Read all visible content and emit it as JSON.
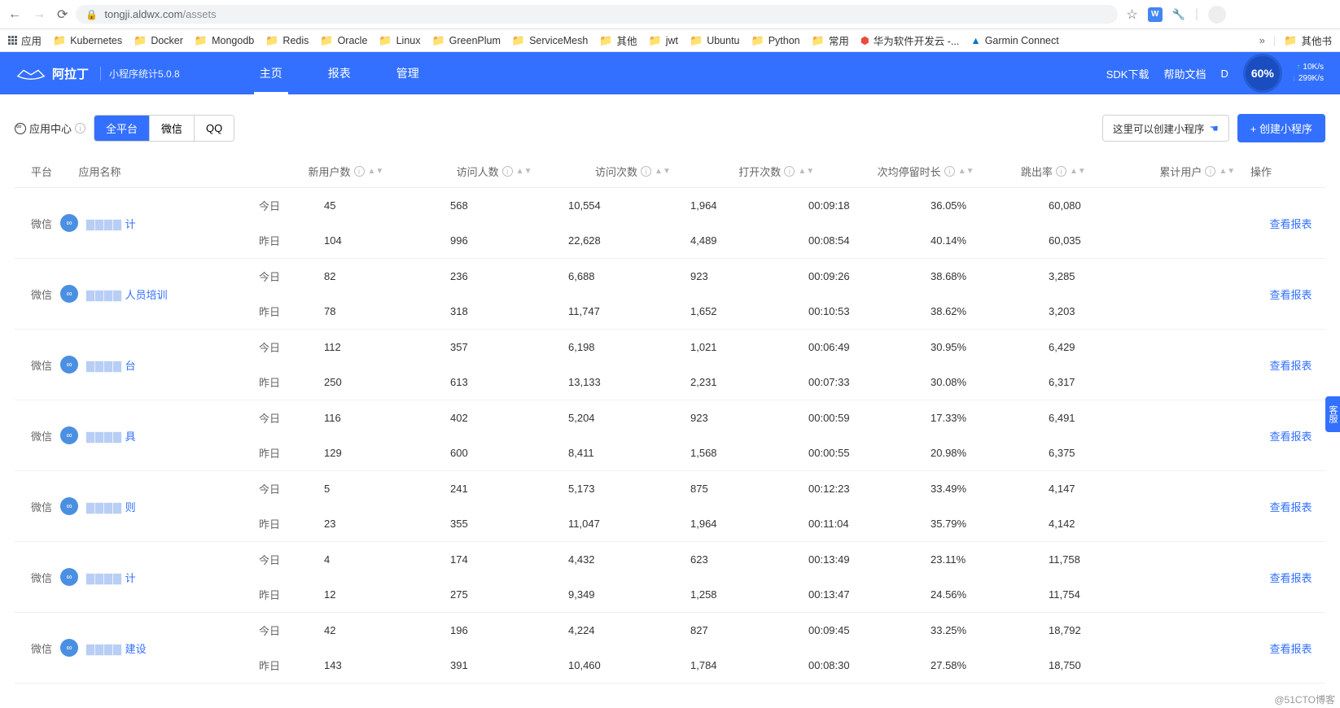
{
  "browser": {
    "url_host": "tongji.aldwx.com",
    "url_path": "/assets",
    "ext_badge": "W",
    "apps_label": "应用"
  },
  "bookmarks": [
    "Kubernetes",
    "Docker",
    "Mongodb",
    "Redis",
    "Oracle",
    "Linux",
    "GreenPlum",
    "ServiceMesh",
    "其他",
    "jwt",
    "Ubuntu",
    "Python",
    "常用"
  ],
  "bookmark_extra": {
    "huawei": "华为软件开发云 -...",
    "garmin": "Garmin Connect",
    "other": "其他书"
  },
  "header": {
    "brand": "阿拉丁",
    "sub": "小程序统计5.0.8",
    "nav": [
      "主页",
      "报表",
      "管理"
    ],
    "right": {
      "sdk": "SDK下载",
      "help": "帮助文档",
      "d_label": "D"
    },
    "gauge": "60%",
    "net_up": "10K/s",
    "net_down": "299K/s"
  },
  "toolbar": {
    "app_center": "应用中心",
    "filters": [
      "全平台",
      "微信",
      "QQ"
    ],
    "hint": "这里可以创建小程序",
    "create": "+ 创建小程序"
  },
  "table": {
    "headers": {
      "platform": "平台",
      "app_name": "应用名称",
      "new_users": "新用户数",
      "visitors": "访问人数",
      "visits": "访问次数",
      "opens": "打开次数",
      "avg_duration": "次均停留时长",
      "bounce_rate": "跳出率",
      "total_users": "累计用户",
      "action": "操作"
    },
    "day_today": "今日",
    "day_yesterday": "昨日",
    "view_report": "查看报表",
    "platform_wechat": "微信",
    "rows": [
      {
        "name_suffix": "计",
        "today": {
          "new": "45",
          "visitors": "568",
          "visits": "10,554",
          "opens": "1,964",
          "duration": "00:09:18",
          "bounce": "36.05%",
          "total": "60,080"
        },
        "yesterday": {
          "new": "104",
          "visitors": "996",
          "visits": "22,628",
          "opens": "4,489",
          "duration": "00:08:54",
          "bounce": "40.14%",
          "total": "60,035"
        }
      },
      {
        "name_suffix": "人员培训",
        "today": {
          "new": "82",
          "visitors": "236",
          "visits": "6,688",
          "opens": "923",
          "duration": "00:09:26",
          "bounce": "38.68%",
          "total": "3,285"
        },
        "yesterday": {
          "new": "78",
          "visitors": "318",
          "visits": "11,747",
          "opens": "1,652",
          "duration": "00:10:53",
          "bounce": "38.62%",
          "total": "3,203"
        }
      },
      {
        "name_suffix": "台",
        "today": {
          "new": "112",
          "visitors": "357",
          "visits": "6,198",
          "opens": "1,021",
          "duration": "00:06:49",
          "bounce": "30.95%",
          "total": "6,429"
        },
        "yesterday": {
          "new": "250",
          "visitors": "613",
          "visits": "13,133",
          "opens": "2,231",
          "duration": "00:07:33",
          "bounce": "30.08%",
          "total": "6,317"
        }
      },
      {
        "name_suffix": "具",
        "today": {
          "new": "116",
          "visitors": "402",
          "visits": "5,204",
          "opens": "923",
          "duration": "00:00:59",
          "bounce": "17.33%",
          "total": "6,491"
        },
        "yesterday": {
          "new": "129",
          "visitors": "600",
          "visits": "8,411",
          "opens": "1,568",
          "duration": "00:00:55",
          "bounce": "20.98%",
          "total": "6,375"
        }
      },
      {
        "name_suffix": "则",
        "today": {
          "new": "5",
          "visitors": "241",
          "visits": "5,173",
          "opens": "875",
          "duration": "00:12:23",
          "bounce": "33.49%",
          "total": "4,147"
        },
        "yesterday": {
          "new": "23",
          "visitors": "355",
          "visits": "11,047",
          "opens": "1,964",
          "duration": "00:11:04",
          "bounce": "35.79%",
          "total": "4,142"
        }
      },
      {
        "name_suffix": "计",
        "today": {
          "new": "4",
          "visitors": "174",
          "visits": "4,432",
          "opens": "623",
          "duration": "00:13:49",
          "bounce": "23.11%",
          "total": "11,758"
        },
        "yesterday": {
          "new": "12",
          "visitors": "275",
          "visits": "9,349",
          "opens": "1,258",
          "duration": "00:13:47",
          "bounce": "24.56%",
          "total": "11,754"
        }
      },
      {
        "name_suffix": "建设",
        "today": {
          "new": "42",
          "visitors": "196",
          "visits": "4,224",
          "opens": "827",
          "duration": "00:09:45",
          "bounce": "33.25%",
          "total": "18,792"
        },
        "yesterday": {
          "new": "143",
          "visitors": "391",
          "visits": "10,460",
          "opens": "1,784",
          "duration": "00:08:30",
          "bounce": "27.58%",
          "total": "18,750"
        }
      }
    ]
  },
  "watermark": "@51CTO博客",
  "side": "客服"
}
